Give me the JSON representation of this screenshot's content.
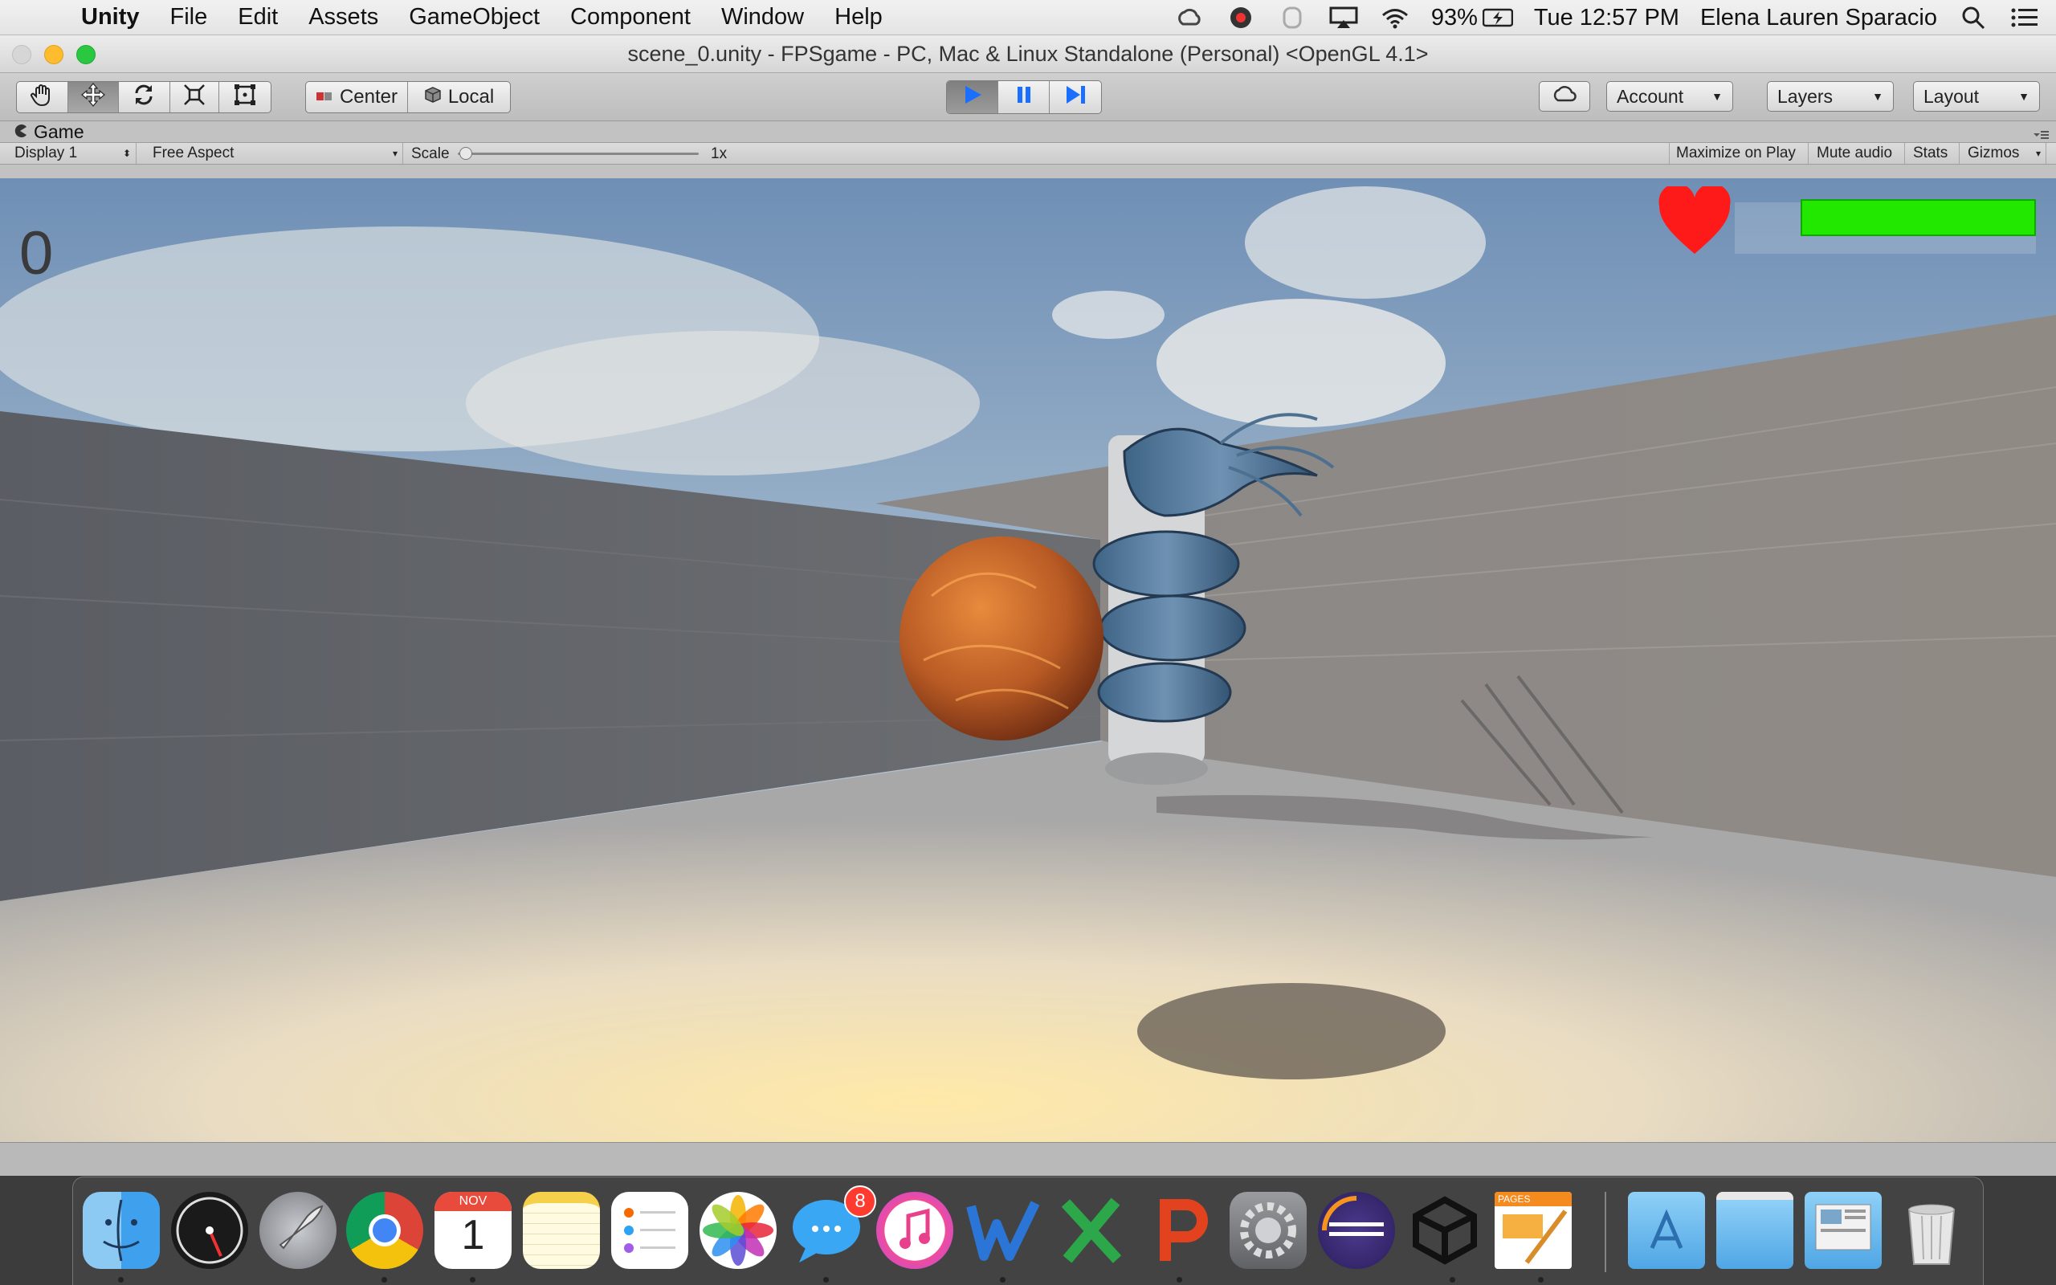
{
  "menubar": {
    "app": "Unity",
    "menus": [
      "File",
      "Edit",
      "Assets",
      "GameObject",
      "Component",
      "Window",
      "Help"
    ],
    "battery": "93%",
    "clock": "Tue 12:57 PM",
    "user": "Elena Lauren Sparacio"
  },
  "window": {
    "title": "scene_0.unity - FPSgame - PC, Mac & Linux Standalone (Personal) <OpenGL 4.1>"
  },
  "toolbar": {
    "pivot": "Center",
    "space": "Local",
    "account": "Account",
    "layers": "Layers",
    "layout": "Layout"
  },
  "game_panel": {
    "tab": "Game",
    "display": "Display 1",
    "aspect": "Free Aspect",
    "scale_label": "Scale",
    "scale_value": "1x",
    "maximize_on_play": "Maximize on Play",
    "mute_audio": "Mute audio",
    "stats": "Stats",
    "gizmos": "Gizmos"
  },
  "hud": {
    "score": "0",
    "health_fraction": 1.0,
    "health_color": "#22e800",
    "heart_color": "#ff1a1a"
  },
  "dock": {
    "calendar_month": "NOV",
    "calendar_day": "1",
    "messages_badge": "8",
    "pages_label": "PAGES"
  },
  "colors": {
    "play_active": "#1a6fff",
    "toolbar_bg": "#c4c4c4"
  }
}
